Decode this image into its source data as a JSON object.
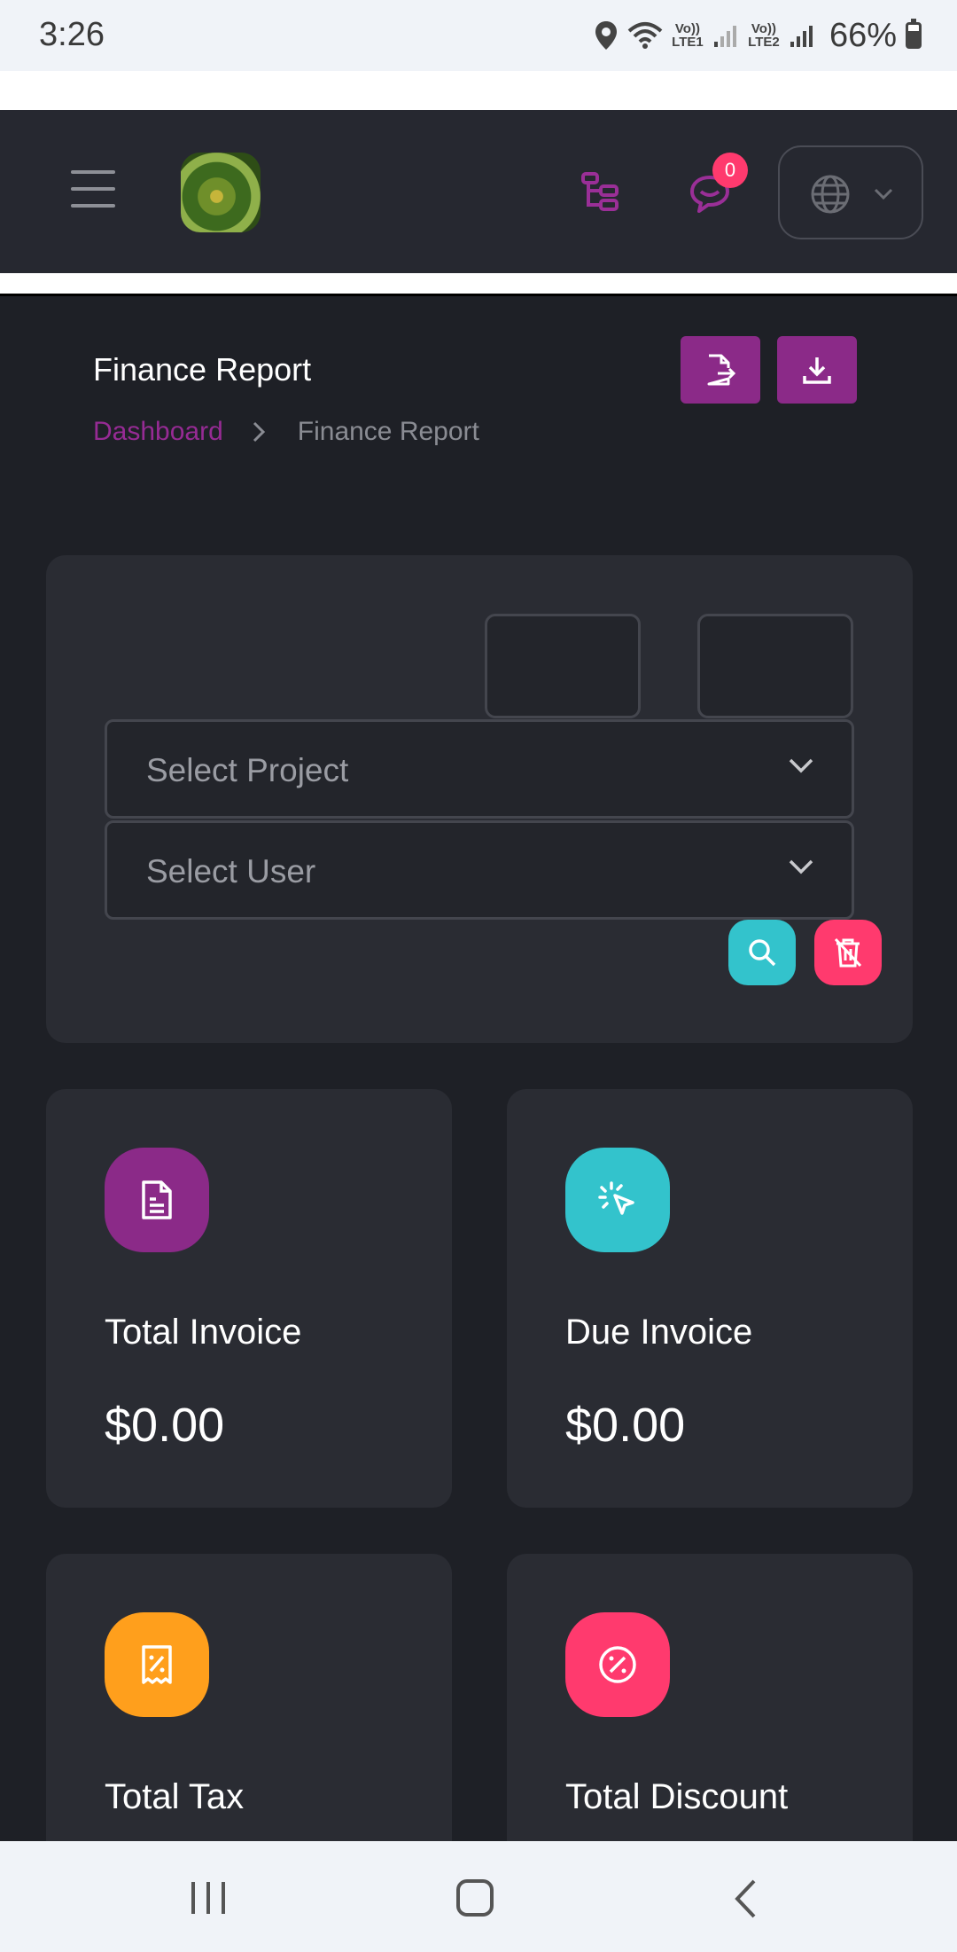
{
  "status_bar": {
    "time": "3:26",
    "sim1_label": "Vo)) LTE1",
    "sim2_label": "Vo)) LTE2",
    "battery": "66%"
  },
  "header": {
    "notification_count": "0",
    "icons": [
      "menu-icon",
      "avatar",
      "sitemap-icon",
      "chat-icon",
      "globe-icon",
      "chevron-down-icon"
    ]
  },
  "page": {
    "title": "Finance Report",
    "breadcrumb": {
      "link": "Dashboard",
      "current": "Finance Report"
    },
    "actions": [
      "export-icon",
      "download-icon"
    ]
  },
  "filters": {
    "project_placeholder": "Select Project",
    "user_placeholder": "Select User",
    "search_icon": "search-icon",
    "reset_icon": "trash-icon"
  },
  "stats": [
    {
      "label": "Total Invoice",
      "value": "$0.00",
      "icon": "invoice-icon",
      "color": "#8b2a88"
    },
    {
      "label": "Due Invoice",
      "value": "$0.00",
      "icon": "click-icon",
      "color": "#33c3cc"
    },
    {
      "label": "Total Tax",
      "value": "",
      "icon": "receipt-percent-icon",
      "color": "#ff9f1c"
    },
    {
      "label": "Total Discount",
      "value": "",
      "icon": "discount-icon",
      "color": "#ff3a6e"
    }
  ],
  "colors": {
    "primary": "#8b2a88",
    "accent_teal": "#33c3cc",
    "accent_pink": "#ff3a6e",
    "accent_orange": "#ff9f1c",
    "background": "#1e2026",
    "card": "#2a2c33"
  }
}
